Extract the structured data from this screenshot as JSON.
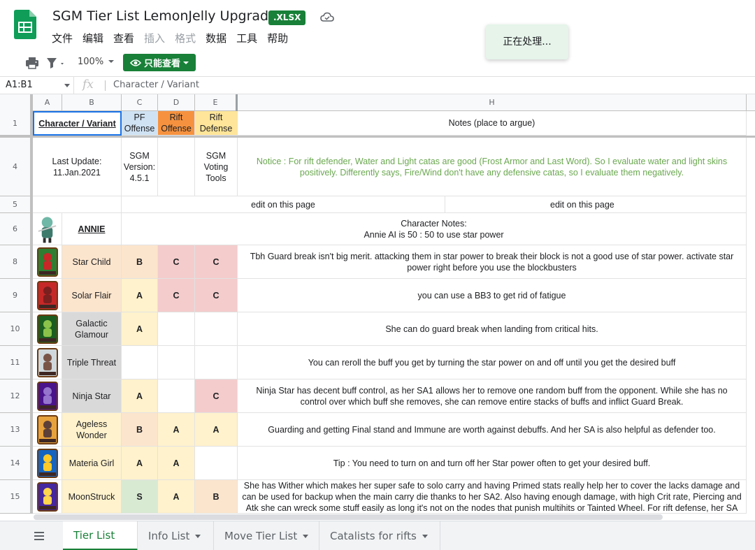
{
  "header": {
    "title": "SGM Tier List LemonJelly Upgraded",
    "badge": ".XLSX",
    "menu": [
      "文件",
      "编辑",
      "查看",
      "插入",
      "格式",
      "数据",
      "工具",
      "帮助"
    ],
    "toast": "正在处理..."
  },
  "toolbar": {
    "zoom": "100%",
    "view_only": "只能查看"
  },
  "formula_bar": {
    "name_box": "A1:B1",
    "fx": "fx",
    "content": "Character  / Variant"
  },
  "columns": [
    "A",
    "B",
    "C",
    "D",
    "E",
    "H"
  ],
  "colors": {
    "pf_header": "#cfe2f3",
    "rift_off_header": "#f6923f",
    "rift_def_header": "#ffe599",
    "tier_s": "#d9ead3",
    "tier_a": "#fff2cc",
    "tier_b": "#fce5cd",
    "tier_c": "#f4cccc",
    "rarity_orange": "#fce5cd",
    "rarity_grey": "#d9d9d9",
    "rarity_yellow": "#fff2cc"
  },
  "header_row": {
    "num": "1",
    "b": "Character  / Variant",
    "c": "PF Offense",
    "d": "Rift Offense",
    "e": "Rift Defense",
    "h": "Notes (place to argue)"
  },
  "row4": {
    "num": "4",
    "b": "Last Update: 11.Jan.2021",
    "c": "SGM Version: 4.5.1",
    "e": "SGM Voting Tools",
    "h": "Notice : For rift defender, Water and Light catas are good (Frost Armor and Last Word). So I evaluate water and light skins positively. Differently says, Fire/Wind don't have any defensive catas, so I evaluate them negatively."
  },
  "row5": {
    "num": "5",
    "left": "edit on this page",
    "right": "edit on this page"
  },
  "row6": {
    "num": "6",
    "character": "ANNIE",
    "notes_title": "Character Notes:",
    "notes": "Annie AI is 50 : 50 to use star power"
  },
  "variants": [
    {
      "num": "8",
      "name": "Star Child",
      "pf": "B",
      "ro": "C",
      "rd": "C",
      "note": "Tbh Guard break isn't big merit. attacking them in star power to break their block is not a good use of star power. activate star power right before you use the blockbusters",
      "rarity": "orange"
    },
    {
      "num": "9",
      "name": "Solar Flair",
      "pf": "A",
      "ro": "C",
      "rd": "C",
      "note": "you can use a BB3 to get rid of fatigue",
      "rarity": "orange"
    },
    {
      "num": "10",
      "name": "Galactic Glamour",
      "pf": "A",
      "ro": "",
      "rd": "",
      "note": "She can do guard break when landing from critical hits.",
      "rarity": "grey"
    },
    {
      "num": "11",
      "name": "Triple Threat",
      "pf": "",
      "ro": "",
      "rd": "",
      "note": "You can reroll the buff you get by turning the star power on and off until you get the desired buff",
      "rarity": "grey"
    },
    {
      "num": "12",
      "name": "Ninja Star",
      "pf": "A",
      "ro": "",
      "rd": "C",
      "note": "Ninja Star has decent buff control, as her SA1 allows her to remove one random buff from the opponent. While she has no control over which buff she removes, she can remove entire stacks of buffs and inflict Guard Break.",
      "rarity": "grey"
    },
    {
      "num": "13",
      "name": "Ageless Wonder",
      "pf": "B",
      "ro": "A",
      "rd": "A",
      "note": "Guarding and getting Final stand and Immune are worth against debuffs. And her SA is also helpful as defender too.",
      "rarity": "yellow"
    },
    {
      "num": "14",
      "name": "Materia Girl",
      "pf": "A",
      "ro": "A",
      "rd": "",
      "note": "Tip : You need to turn on and turn off her Star power often to get your desired buff.",
      "rarity": "yellow"
    },
    {
      "num": "15",
      "name": "MoonStruck",
      "pf": "S",
      "ro": "A",
      "rd": "B",
      "note": "She has Wither which makes her super safe to solo carry and having Primed stats really help her to cover the lacks damage and can be used for backup when the main carry die thanks to her SA2. Also having enough damage, with high Crit rate, Piercing and Atk she can wreck some stuff easily as long it's not on the nodes that punish multihits or Tainted Wheel. For rift defense, her SA",
      "rarity": "yellow"
    }
  ],
  "tabs": [
    {
      "label": "Tier List",
      "active": true
    },
    {
      "label": "Info List",
      "active": false
    },
    {
      "label": "Move Tier List",
      "active": false
    },
    {
      "label": "Catalists for rifts",
      "active": false
    }
  ]
}
